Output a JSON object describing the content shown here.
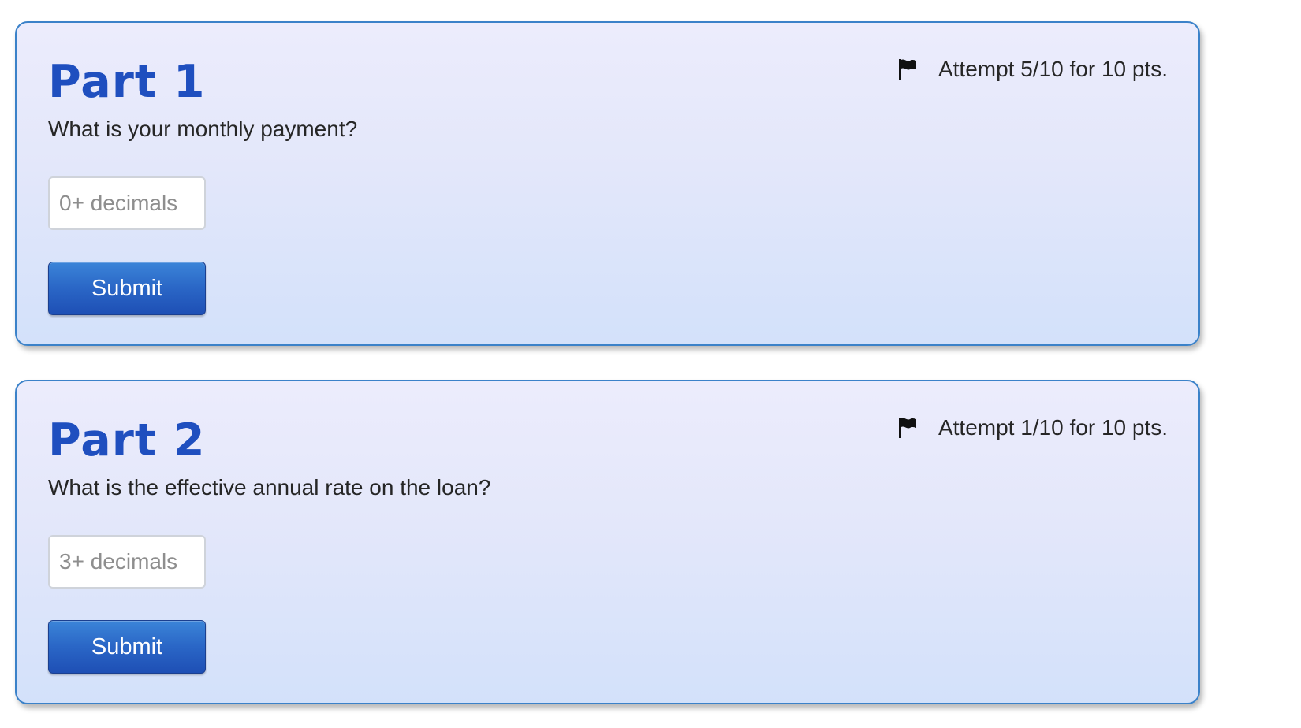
{
  "parts": [
    {
      "title": "Part 1",
      "question": "What is your monthly payment?",
      "attempt": "Attempt 5/10 for 10 pts.",
      "input_placeholder": "0+ decimals",
      "input_value": "",
      "submit_label": "Submit",
      "flag_icon": "flag-icon"
    },
    {
      "title": "Part 2",
      "question": "What is the effective annual rate on the loan?",
      "attempt": "Attempt 1/10 for 10 pts.",
      "input_placeholder": "3+ decimals",
      "input_value": "",
      "submit_label": "Submit",
      "flag_icon": "flag-icon"
    }
  ],
  "colors": {
    "title": "#1f4fbf",
    "card_border": "#3b82c9",
    "card_bg_top": "#ececfc",
    "card_bg_bottom": "#d3e1fa",
    "button": "#2a66c6"
  }
}
